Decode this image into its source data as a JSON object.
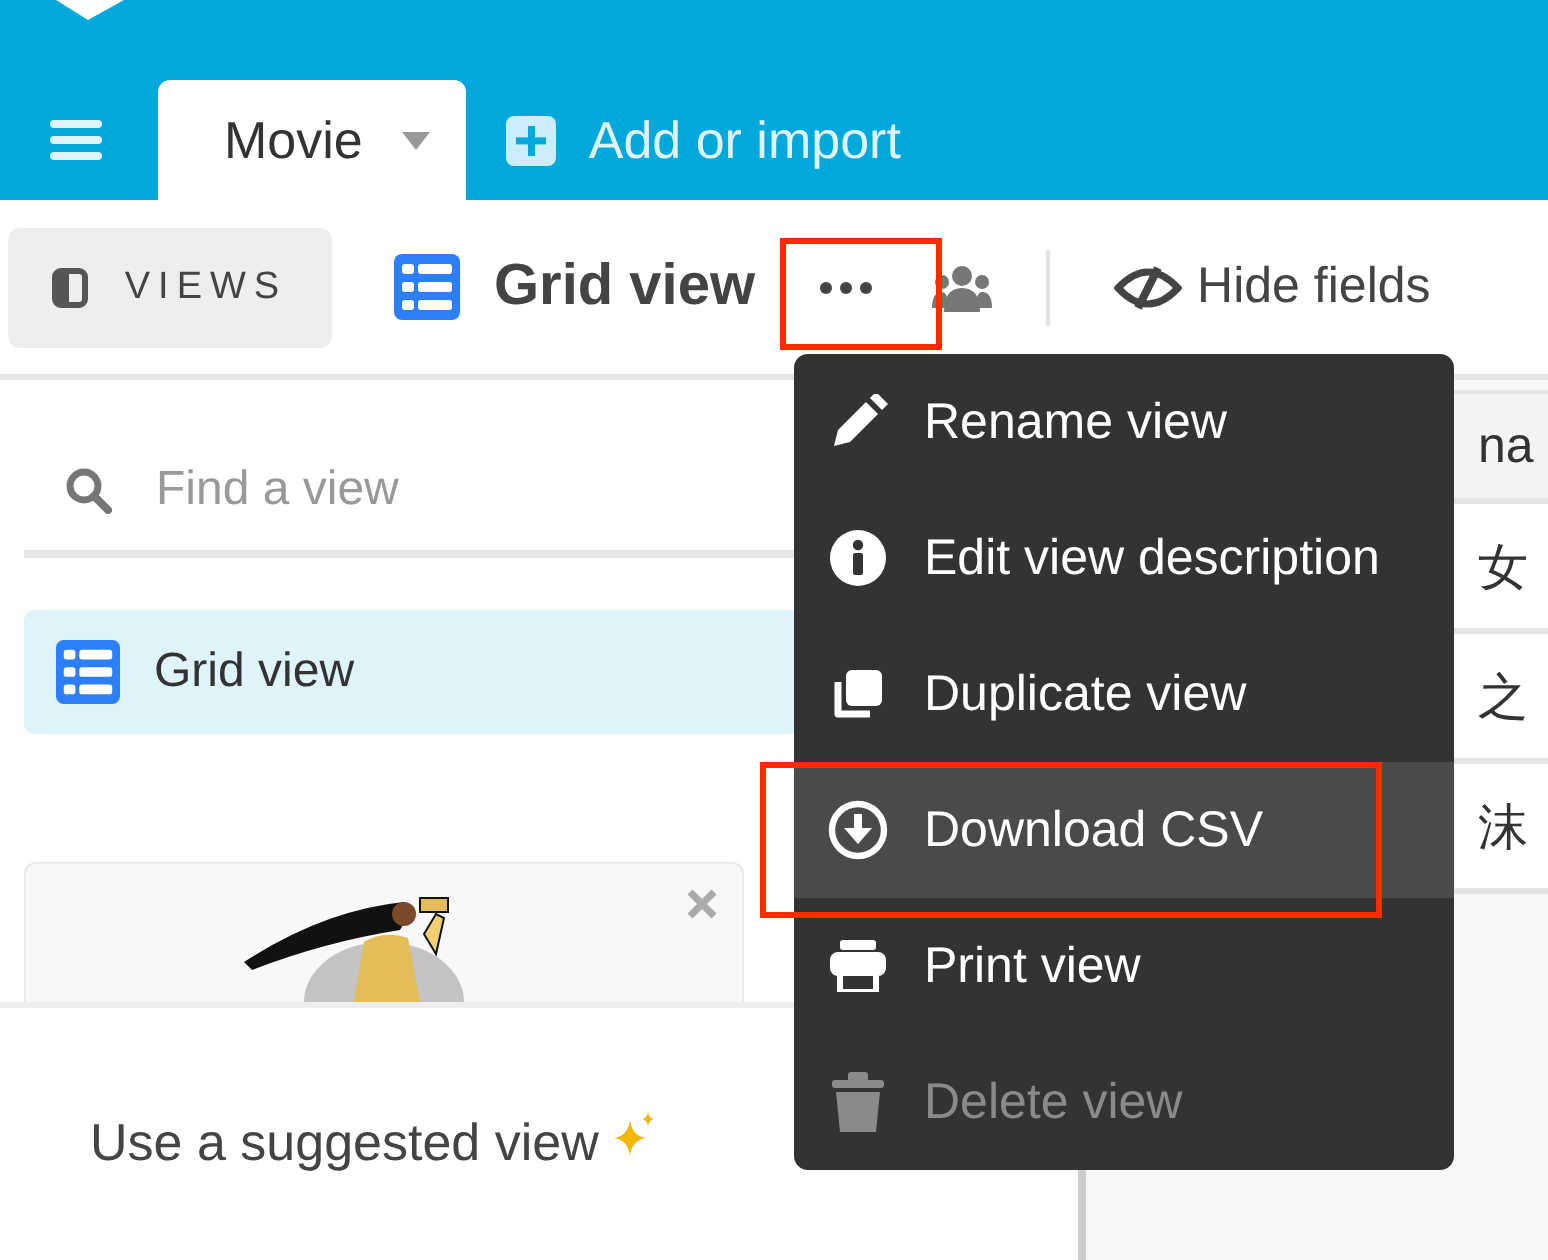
{
  "header": {
    "tabs": [
      {
        "label": "Movie",
        "selected": true
      }
    ],
    "add_button": "Add or import"
  },
  "toolbar": {
    "views_button": "VIEWS",
    "view_name": "Grid view",
    "hide_fields": "Hide fields"
  },
  "sidebar": {
    "search": {
      "placeholder": "Find a view"
    },
    "views": [
      {
        "label": "Grid view",
        "selected": true
      }
    ],
    "suggested_title": "Use a suggested view"
  },
  "table": {
    "column": "na",
    "rows": [
      "女",
      "之",
      "沫"
    ]
  },
  "menu": {
    "items": [
      {
        "label": "Rename view",
        "kind": "rename",
        "selected": false,
        "disabled": false
      },
      {
        "label": "Edit view description",
        "kind": "info",
        "selected": false,
        "disabled": false
      },
      {
        "label": "Duplicate view",
        "kind": "duplicate",
        "selected": false,
        "disabled": false
      },
      {
        "label": "Download CSV",
        "kind": "download",
        "selected": true,
        "disabled": false
      },
      {
        "label": "Print view",
        "kind": "print",
        "selected": false,
        "disabled": false
      },
      {
        "label": "Delete view",
        "kind": "delete",
        "selected": false,
        "disabled": true
      }
    ]
  }
}
